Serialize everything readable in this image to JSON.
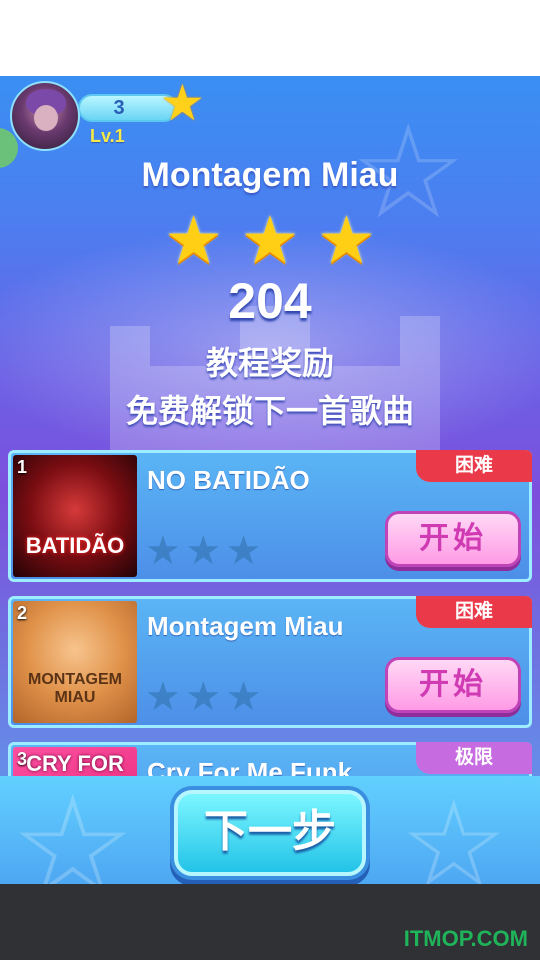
{
  "player": {
    "level_count": "3",
    "level_label": "Lv.1"
  },
  "result": {
    "song_title": "Montagem Miau",
    "stars": [
      "★",
      "★",
      "★"
    ],
    "score": "204",
    "reward_title": "教程奖励",
    "reward_subtitle": "免费解锁下一首歌曲"
  },
  "songs": [
    {
      "rank": "1",
      "title": "NO BATIDÃO",
      "difficulty": "困难",
      "stars": [
        "★",
        "★",
        "★"
      ],
      "start_label": "开始",
      "cover_text": "BATIDÃO"
    },
    {
      "rank": "2",
      "title": "Montagem Miau",
      "difficulty": "困难",
      "stars": [
        "★",
        "★",
        "★"
      ],
      "start_label": "开始",
      "cover_text": "MONTAGEM MIAU"
    },
    {
      "rank": "3",
      "title": "Cry For Me Funk",
      "difficulty": "极限",
      "cover_text": "CRY FOR"
    }
  ],
  "next_button": "下一步",
  "watermark": "ITMOP.COM",
  "colors": {
    "hard_badge": "#ea3a4a",
    "extreme_badge": "#c66be0",
    "start_button": "#ff9be6",
    "next_button": "#23c3e8"
  }
}
